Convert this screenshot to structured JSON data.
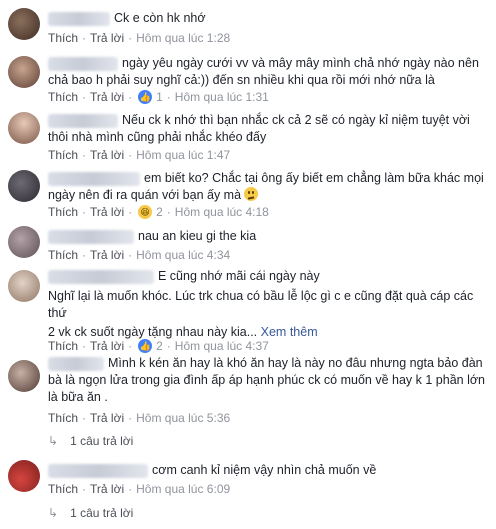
{
  "actions": {
    "like": "Thích",
    "reply": "Trả lời"
  },
  "comments": [
    {
      "text": "Ck e còn hk nhớ",
      "time": "Hôm qua lúc 1:28",
      "reactions": null
    },
    {
      "text": "ngày yêu ngày cưới vv và mây mây mình chả nhớ ngày nào nên chả bao h phải suy nghĩ cả:)) đến sn nhiều khi qua rồi mới nhớ nữa là",
      "time": "Hôm qua lúc 1:31",
      "reactions": {
        "count": "1"
      }
    },
    {
      "text": "Nếu ck k nhớ thì bạn nhắc ck cả 2 sẽ có ngày kỉ niệm tuyệt vời thôi nhà mình cũng phải nhắc khéo đấy",
      "time": "Hôm qua lúc 1:47",
      "reactions": null
    },
    {
      "text": "em biết ko? Chắc tại ông ấy biết em chẳng làm bữa khác mọi ngày nên đi ra quán với bạn ấy mà",
      "time": "Hôm qua lúc 4:18",
      "reactions": {
        "count": "2"
      }
    },
    {
      "text": "nau an kieu gi the kia",
      "time": "Hôm qua lúc 4:34",
      "reactions": null
    },
    {
      "text_line1": "E cũng nhớ mãi cái ngày này",
      "text_rest": "Nghĩ lại là muốn khóc. Lúc trk chua có bầu lễ lộc gì c e cũng đặt quà cáp các thứ",
      "text_last": "2 vk ck suốt ngày tặng nhau này kia...",
      "see_more": "Xem thêm",
      "time": "Hôm qua lúc 4:37",
      "reactions": {
        "count": "2"
      }
    },
    {
      "text": "Mình k kén ăn hay là khó ăn hay là này no đâu nhưng ngta bảo đàn bà là ngọn lửa trong gia đình ấp áp hạnh phúc ck có muốn về hay k 1 phần lớn là bữa ăn .",
      "time": "Hôm qua lúc 5:36",
      "reactions": null,
      "replies": "1 câu trả lời"
    },
    {
      "text": "cơm canh kỉ niệm vậy nhìn chả muốn về",
      "time": "Hôm qua lúc 6:09",
      "reactions": null,
      "replies": "1 câu trả lời"
    }
  ]
}
